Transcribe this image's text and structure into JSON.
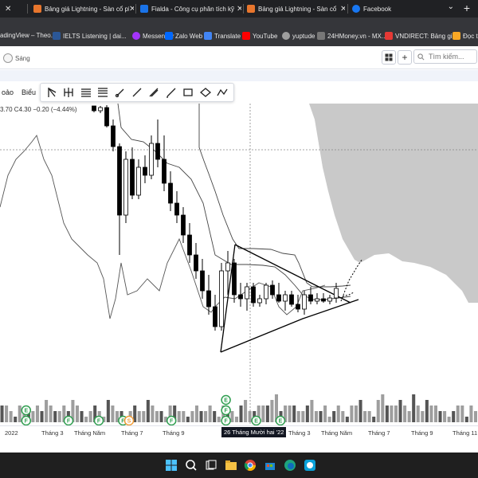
{
  "tabs": [
    {
      "label": "Bảng giá Lightning - Sàn cổ phiếu",
      "color": "#e8762d"
    },
    {
      "label": "Fialda - Công cụ phân tích kỹ thuật",
      "color": "#1a73e8"
    },
    {
      "label": "Bảng giá Lightning - Sàn cổ phiếu",
      "color": "#e8762d"
    },
    {
      "label": "Facebook",
      "color": "#1877f2"
    }
  ],
  "bookmarks": [
    {
      "label": "adingView – Theo...",
      "color": "#555"
    },
    {
      "label": "IELTS Listening | dai...",
      "color": "#2b5797"
    },
    {
      "label": "Messenger",
      "color": "#a334fa"
    },
    {
      "label": "Zalo Web",
      "color": "#0068ff"
    },
    {
      "label": "Translate",
      "color": "#4285f4"
    },
    {
      "label": "YouTube",
      "color": "#ff0000"
    },
    {
      "label": "yuptude",
      "color": "#9e9e9e"
    },
    {
      "label": "24HMoney.vn - MX...",
      "color": "#777"
    },
    {
      "label": "VNDIRECT: Bảng gi...",
      "color": "#e53935"
    },
    {
      "label": "Đọc tr",
      "color": "#f9a825"
    }
  ],
  "app": {
    "theme_toggle_label": "Sáng",
    "grid_icon": "grid-icon",
    "search_placeholder": "Tìm kiếm...",
    "left_labels": [
      "oảo",
      "Biểu"
    ],
    "legend": "3.70  C4.30  −0.20 (−4.44%)"
  },
  "drawing_tools": [
    "fib-fan-icon",
    "pitchfork-icon",
    "parallel-channel-icon",
    "trend-line-icon",
    "ray-icon",
    "brush-icon",
    "rectangle-icon",
    "ellipse-icon",
    "path-icon"
  ],
  "time_axis": {
    "labels": [
      "2022",
      "Tháng 3",
      "Tháng Năm",
      "Tháng 7",
      "Tháng 9",
      "Tháng 3",
      "Tháng Năm",
      "Tháng 7",
      "Tháng 9",
      "Tháng 11"
    ],
    "crosshair_label": "26 Tháng Mười hai '22"
  },
  "colors": {
    "bull": "#ffffff",
    "bear": "#000000",
    "cloud": "#c9c9c9",
    "volume_gray": "#9e9e9e",
    "badge_green": "#2e9e4f",
    "badge_orange": "#f29d38"
  },
  "chart_data": {
    "type": "candlestick",
    "title": "",
    "xlabel": "",
    "ylabel": "",
    "candles": [
      {
        "o": 3,
        "h": 5,
        "l": 11,
        "c": 9
      },
      {
        "o": 9,
        "h": 3,
        "l": 12,
        "c": 5
      },
      {
        "o": 5,
        "h": 2,
        "l": 30,
        "c": 28
      },
      {
        "o": 28,
        "h": 20,
        "l": 60,
        "c": 54
      },
      {
        "o": 54,
        "h": 50,
        "l": 190,
        "c": 140
      },
      {
        "o": 140,
        "h": 60,
        "l": 150,
        "c": 70
      },
      {
        "o": 70,
        "h": 55,
        "l": 120,
        "c": 115
      },
      {
        "o": 115,
        "h": 70,
        "l": 120,
        "c": 80
      },
      {
        "o": 80,
        "h": 65,
        "l": 100,
        "c": 90
      },
      {
        "o": 90,
        "h": 40,
        "l": 95,
        "c": 50
      },
      {
        "o": 50,
        "h": 20,
        "l": 80,
        "c": 70
      },
      {
        "o": 70,
        "h": 40,
        "l": 110,
        "c": 100
      },
      {
        "o": 100,
        "h": 85,
        "l": 135,
        "c": 125
      },
      {
        "o": 125,
        "h": 110,
        "l": 150,
        "c": 140
      },
      {
        "o": 140,
        "h": 130,
        "l": 175,
        "c": 165
      },
      {
        "o": 165,
        "h": 150,
        "l": 200,
        "c": 190
      },
      {
        "o": 190,
        "h": 175,
        "l": 220,
        "c": 210
      },
      {
        "o": 210,
        "h": 195,
        "l": 245,
        "c": 235
      },
      {
        "o": 235,
        "h": 215,
        "l": 265,
        "c": 255
      },
      {
        "o": 255,
        "h": 240,
        "l": 285,
        "c": 280
      },
      {
        "o": 280,
        "h": 200,
        "l": 285,
        "c": 210
      },
      {
        "o": 210,
        "h": 185,
        "l": 240,
        "c": 200
      },
      {
        "o": 200,
        "h": 195,
        "l": 250,
        "c": 240
      },
      {
        "o": 240,
        "h": 225,
        "l": 255,
        "c": 245
      },
      {
        "o": 245,
        "h": 225,
        "l": 260,
        "c": 230
      },
      {
        "o": 230,
        "h": 225,
        "l": 255,
        "c": 250
      },
      {
        "o": 250,
        "h": 240,
        "l": 255,
        "c": 245
      },
      {
        "o": 245,
        "h": 225,
        "l": 252,
        "c": 228
      },
      {
        "o": 228,
        "h": 222,
        "l": 245,
        "c": 240
      },
      {
        "o": 240,
        "h": 225,
        "l": 250,
        "c": 248
      },
      {
        "o": 248,
        "h": 235,
        "l": 260,
        "c": 240
      },
      {
        "o": 240,
        "h": 235,
        "l": 255,
        "c": 252
      },
      {
        "o": 252,
        "h": 240,
        "l": 262,
        "c": 258
      },
      {
        "o": 258,
        "h": 235,
        "l": 265,
        "c": 240
      },
      {
        "o": 240,
        "h": 230,
        "l": 252,
        "c": 248
      },
      {
        "o": 248,
        "h": 238,
        "l": 252,
        "c": 245
      },
      {
        "o": 245,
        "h": 238,
        "l": 250,
        "c": 248
      },
      {
        "o": 248,
        "h": 240,
        "l": 252,
        "c": 244
      },
      {
        "o": 244,
        "h": 225,
        "l": 250,
        "c": 232
      }
    ],
    "volume": [
      3,
      3,
      2,
      1,
      3,
      2,
      2,
      2,
      3,
      2,
      4,
      3,
      2,
      2,
      3,
      2,
      4,
      3,
      2,
      1,
      2,
      3,
      2,
      1,
      4,
      3,
      2,
      2,
      1,
      2,
      3,
      2,
      2,
      4,
      3,
      2,
      2,
      1,
      3,
      3,
      2,
      2,
      1,
      2,
      3,
      2,
      2,
      3,
      2,
      1,
      3,
      2,
      2,
      1,
      3,
      4,
      2,
      2,
      3,
      3,
      3,
      4,
      5,
      2,
      3,
      3,
      3,
      2,
      2,
      3,
      4,
      2,
      2,
      3,
      1,
      2,
      3,
      2,
      1,
      3,
      3,
      4,
      2,
      2,
      1,
      4,
      5,
      3,
      3,
      3,
      4,
      3,
      2,
      5,
      3,
      2,
      4,
      3,
      3,
      2,
      2,
      1,
      2,
      3,
      3,
      1,
      3,
      2
    ],
    "badges": [
      {
        "slot": 3,
        "letter": "F",
        "kind": "green"
      },
      {
        "slot": 3,
        "letter": "E",
        "kind": "green"
      },
      {
        "slot": 10,
        "letter": "F",
        "kind": "green"
      },
      {
        "slot": 15,
        "letter": "F",
        "kind": "green"
      },
      {
        "slot": 19,
        "letter": "F",
        "kind": "green"
      },
      {
        "slot": 20,
        "letter": "S",
        "kind": "orange"
      },
      {
        "slot": 27,
        "letter": "F",
        "kind": "green"
      },
      {
        "slot": 36,
        "letter": "F",
        "kind": "green"
      },
      {
        "slot": 36,
        "letter": "F",
        "kind": "green"
      },
      {
        "slot": 36,
        "letter": "E",
        "kind": "green"
      },
      {
        "slot": 41,
        "letter": "E",
        "kind": "green"
      },
      {
        "slot": 45,
        "letter": "E",
        "kind": "green"
      }
    ]
  }
}
